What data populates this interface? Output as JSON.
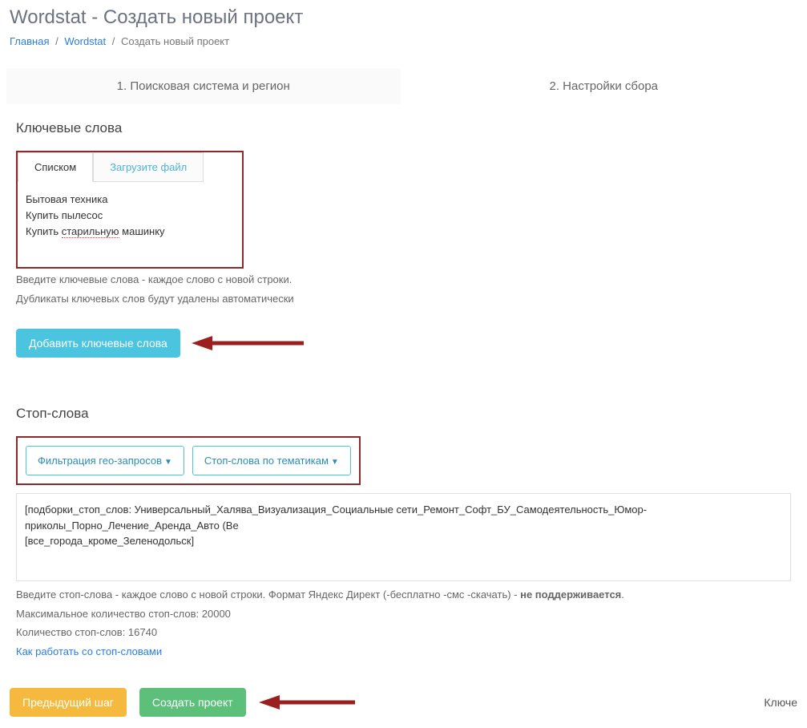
{
  "page": {
    "title": "Wordstat - Создать новый проект"
  },
  "breadcrumb": {
    "home": "Главная",
    "wordstat": "Wordstat",
    "current": "Создать новый проект"
  },
  "steps": {
    "step1": "1. Поисковая система и регион",
    "step2": "2. Настройки сбора"
  },
  "keywords": {
    "section_title": "Ключевые слова",
    "tab_list": "Списком",
    "tab_upload": "Загрузите файл",
    "line1": "Бытовая техника",
    "line2": "Купить пылесос",
    "line3_a": "Купить ",
    "line3_err": "старильную",
    "line3_b": " машинку",
    "help1": "Введите ключевые слова - каждое слово с новой строки.",
    "help2": "Дубликаты ключевых слов будут удалены автоматически",
    "add_btn": "Добавить ключевые слова"
  },
  "stopwords": {
    "section_title": "Стоп-слова",
    "geo_filter": "Фильтрация гео-запросов",
    "by_topic": "Стоп-слова по тематикам",
    "textarea_value": "[подборки_стоп_слов: Универсальный_Халява_Визуализация_Социальные сети_Ремонт_Софт_БУ_Самодеятельность_Юмор-приколы_Порно_Лечение_Аренда_Авто (Ве\n[все_города_кроме_Зеленодольск]",
    "help1_a": "Введите стоп-слова - каждое слово с новой строки. Формат Яндекс Директ (-бесплатно -смс -скачать) - ",
    "help1_b": "не поддерживается",
    "help1_c": ".",
    "help2": "Максимальное количество стоп-слов: 20000",
    "help3": "Количество стоп-слов: 16740",
    "help_link": "Как работать со стоп-словами"
  },
  "footer": {
    "prev": "Предыдущий шаг",
    "create": "Создать проект",
    "right_text": "Ключе"
  }
}
